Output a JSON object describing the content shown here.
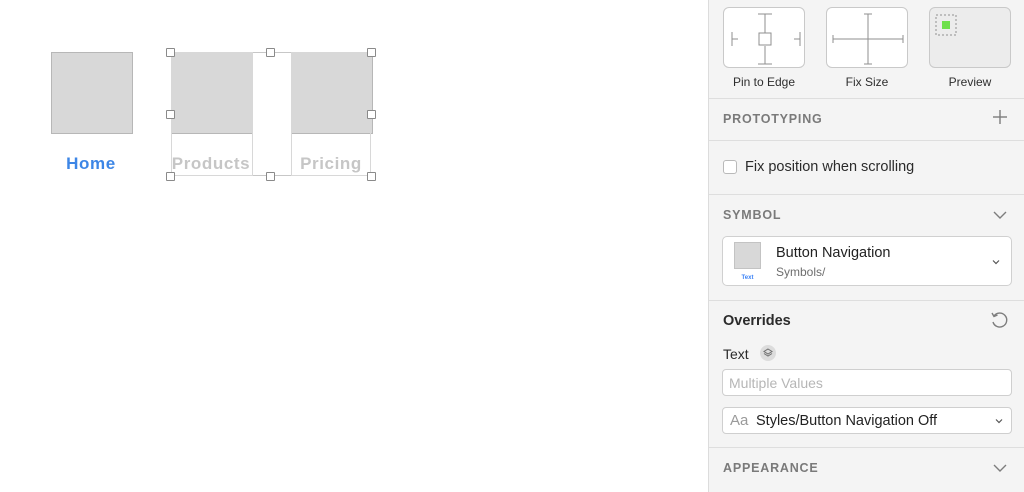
{
  "canvas": {
    "nav_items": [
      {
        "label": "Home",
        "color": "#3d86e6",
        "selected": false
      },
      {
        "label": "Products",
        "color": "#c6c6c6",
        "selected": true
      },
      {
        "label": "Pricing",
        "color": "#c6c6c6",
        "selected": true
      }
    ]
  },
  "inspector": {
    "resizing": {
      "pin_to_edge": "Pin to Edge",
      "fix_size": "Fix Size",
      "preview": "Preview"
    },
    "prototyping": {
      "title": "PROTOTYPING",
      "fix_position_label": "Fix position when scrolling",
      "fix_position_checked": false
    },
    "symbol": {
      "title": "SYMBOL",
      "thumb_text": "Text",
      "name": "Button Navigation",
      "path": "Symbols/"
    },
    "overrides": {
      "title": "Overrides",
      "text_label": "Text",
      "text_placeholder": "Multiple Values",
      "style_prefix": "Aa",
      "style_value": "Styles/Button Navigation Off"
    },
    "appearance": {
      "title": "APPEARANCE"
    }
  },
  "colors": {
    "accent_blue": "#3d86e6",
    "preview_green": "#6ee04b",
    "muted_text": "#c6c6c6"
  }
}
